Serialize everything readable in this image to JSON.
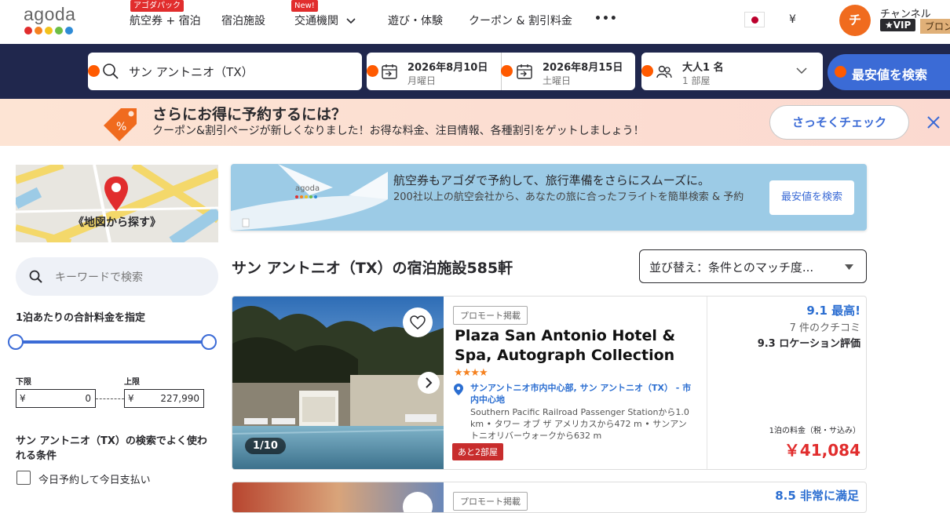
{
  "nav": {
    "logo": "agoda",
    "items": [
      {
        "label": "航空券 + 宿泊",
        "badge": "アゴダパック"
      },
      {
        "label": "宿泊施設"
      },
      {
        "label": "交通機関",
        "badge": "New!"
      },
      {
        "label": "遊び・体験"
      },
      {
        "label": "クーポン & 割引料金"
      },
      {
        "label": "•••"
      }
    ],
    "currency": "¥",
    "avatar_initial": "チ",
    "username": "チャンネル",
    "vip": "★VIP",
    "tier": "ブロンズ"
  },
  "search": {
    "destination": "サン アントニオ（TX）",
    "checkin_date": "2026年8月10日",
    "checkin_day": "月曜日",
    "checkout_date": "2026年8月15日",
    "checkout_day": "土曜日",
    "guests": "大人1 名",
    "rooms": "1 部屋",
    "button": "最安値を検索"
  },
  "promo": {
    "title": "さらにお得に予約するには？",
    "subtitle": "クーポン&割引ページが新しくなりました！お得な料金、注目情報、各種割引をゲットしましょう！",
    "button": "さっそくチェック"
  },
  "sidebar": {
    "map_label": "《地図から探す》",
    "keyword_placeholder": "キーワードで検索",
    "price_title": "1泊あたりの合計料金を指定",
    "min_label": "下限",
    "max_label": "上限",
    "currency": "¥",
    "min_value": "0",
    "max_value": "227,990",
    "popular_title": "サン アントニオ（TX）の検索でよく使われる条件",
    "filters": [
      "今日予約して今日支払い"
    ]
  },
  "flight_banner": {
    "brand": "agoda",
    "line1": "航空券もアゴダで予約して、旅行準備をさらにスムーズに。",
    "line2": "200社以上の航空会社から、あなたの旅に合ったフライトを簡単検索 & 予約",
    "button": "最安値を検索"
  },
  "results": {
    "title": "サン アントニオ（TX）の宿泊施設585軒",
    "sort_label": "並び替え：条件とのマッチ度..."
  },
  "hotels": [
    {
      "promo_tag": "プロモート掲載",
      "name": "Plaza San Antonio Hotel & Spa, Autograph Collection",
      "stars": "★★★★",
      "location": "サンアントニオ市内中心部, サン アントニオ（TX） - 市内中心地",
      "distance": "Southern Pacific Railroad Passenger Stationから1.0 km • タワー オブ ザ アメリカスから472 m • サンアントニオリバーウォークから632 m",
      "rooms_left": "あと2部屋",
      "image_counter": "1/10",
      "score": "9.1 最高!",
      "reviews": "7 件のクチコミ",
      "location_score": "9.3 ロケーション評価",
      "price_note": "1泊の料金（税・サ込み）",
      "price": "￥41,084"
    },
    {
      "promo_tag": "プロモート掲載",
      "score": "8.5 非常に満足"
    }
  ]
}
